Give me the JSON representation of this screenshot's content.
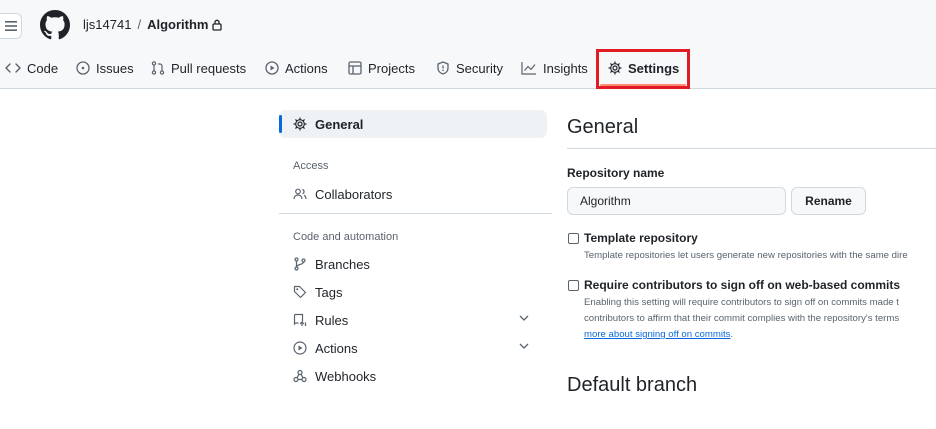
{
  "header": {
    "owner": "ljs14741",
    "separator": "/",
    "repo": "Algorithm",
    "tabs": {
      "code": "Code",
      "issues": "Issues",
      "pull_requests": "Pull requests",
      "actions": "Actions",
      "projects": "Projects",
      "security": "Security",
      "insights": "Insights",
      "settings": "Settings"
    },
    "highlight_color": "#e01b24",
    "active_underline_color": "#fd8c73"
  },
  "sidebar": {
    "general": "General",
    "access_heading": "Access",
    "collaborators": "Collaborators",
    "code_heading": "Code and automation",
    "branches": "Branches",
    "tags": "Tags",
    "rules": "Rules",
    "actions": "Actions",
    "webhooks": "Webhooks",
    "accent_color": "#0969da"
  },
  "main": {
    "title": "General",
    "repo_name_label": "Repository name",
    "repo_name_value": "Algorithm",
    "rename_label": "Rename",
    "template_label": "Template repository",
    "template_desc": "Template repositories let users generate new repositories with the same dire",
    "signoff_label": "Require contributors to sign off on web-based commits",
    "signoff_desc_1": "Enabling this setting will require contributors to sign off on commits made t",
    "signoff_desc_2": "contributors to affirm that their commit complies with the repository's terms",
    "signoff_link": "more about signing off on commits",
    "signoff_link_suffix": ".",
    "default_branch_title": "Default branch"
  }
}
